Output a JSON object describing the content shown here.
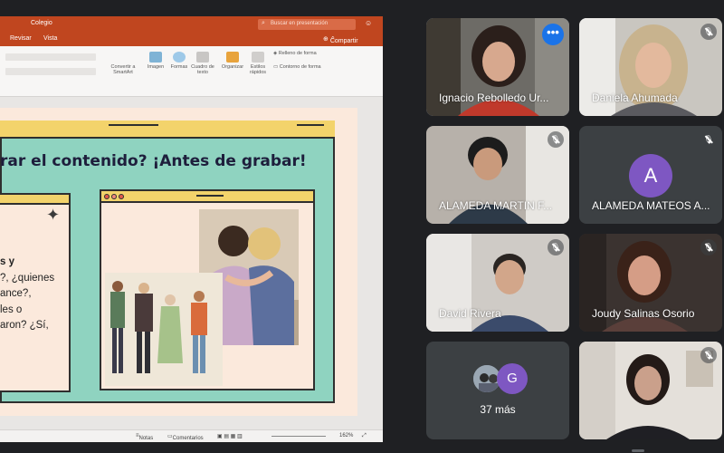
{
  "ppt": {
    "doc_title": "Colegio",
    "search_placeholder": "Buscar en presentación",
    "tabs": [
      "Revisar",
      "Vista"
    ],
    "share_label": "Compartir",
    "ribbon": {
      "convert": "Convertir a SmartArt",
      "image": "Imagen",
      "shapes": "Formas",
      "textbox": "Cuadro de texto",
      "arrange": "Organizar",
      "quick_styles": "Estilos rápidos",
      "shape_fill": "Relleno de forma",
      "shape_outline": "Contorno de forma"
    },
    "status": {
      "notes": "Notas",
      "comments": "Comentarios",
      "zoom": "162%"
    }
  },
  "slide": {
    "title": "rar el contenido? ¡Antes de grabar!",
    "left_text": [
      "s y",
      "?, ¿quienes",
      "ance?,",
      "les o",
      "aron? ¿Sí,"
    ]
  },
  "participants": [
    {
      "name": "Ignacio Rebolledo Ur...",
      "muted": false,
      "speaking": true
    },
    {
      "name": "Daniela Ahumada",
      "muted": true
    },
    {
      "name": "ALAMEDA MARTIN F...",
      "muted": true
    },
    {
      "name": "ALAMEDA MATEOS A...",
      "muted": true,
      "avatar_letter": "A"
    },
    {
      "name": "David Rivera",
      "muted": true
    },
    {
      "name": "Joudy Salinas Osorio",
      "muted": true
    },
    {
      "more_label": "37 más",
      "avatar_letter": "G"
    },
    {
      "name": "",
      "muted": true
    }
  ],
  "colors": {
    "ppt_brand": "#c0461f",
    "meet_background": "#1f2023",
    "tile": "#3c4043",
    "slide_teal": "#8fd3c0",
    "slide_yellow": "#f3d36b",
    "avatar_purple": "#7e57c2",
    "active_blue": "#1a73e8"
  }
}
